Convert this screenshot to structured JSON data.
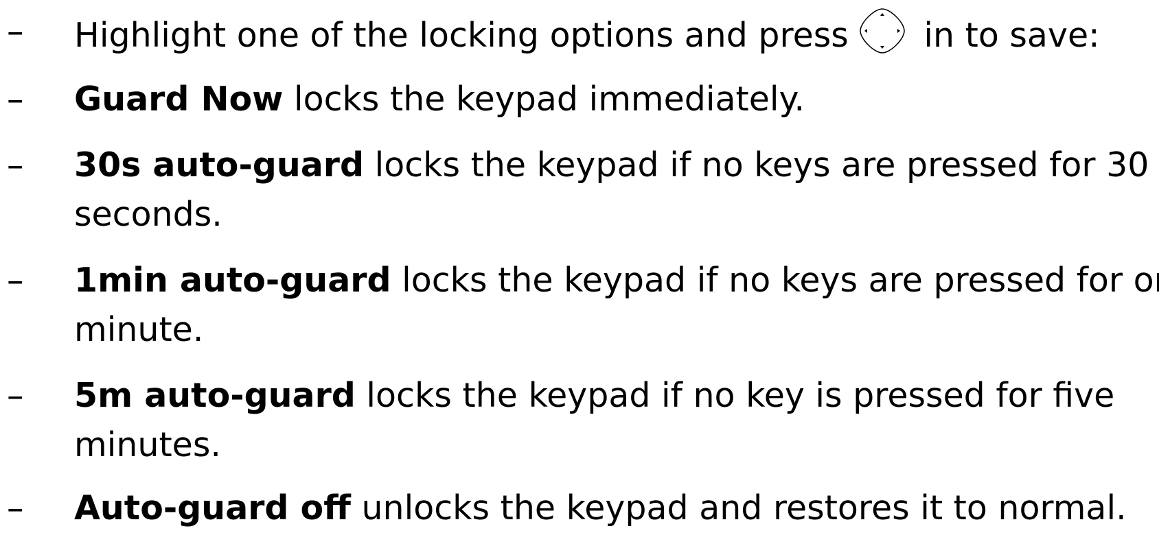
{
  "instructions": [
    {
      "bullet": "–",
      "before": "Highlight one of the locking options and press",
      "icon": "navigation-key-icon",
      "after": " in to save:"
    },
    {
      "bullet": "–",
      "bold": "Guard Now",
      "line1": " locks the keypad immediately."
    },
    {
      "bullet": "–",
      "bold": "30s auto-guard",
      "line1": " locks the keypad if no keys are pressed for 30",
      "line2": "seconds."
    },
    {
      "bullet": "–",
      "bold": "1min auto-guard",
      "line1": " locks the keypad if no keys are pressed for one",
      "line2": "minute."
    },
    {
      "bullet": "–",
      "bold": "5m auto-guard",
      "line1": " locks the keypad if no key is pressed for five",
      "line2": "minutes."
    },
    {
      "bullet": "–",
      "bold": "Auto-guard off",
      "line1": " unlocks the keypad and restores it to normal."
    }
  ]
}
